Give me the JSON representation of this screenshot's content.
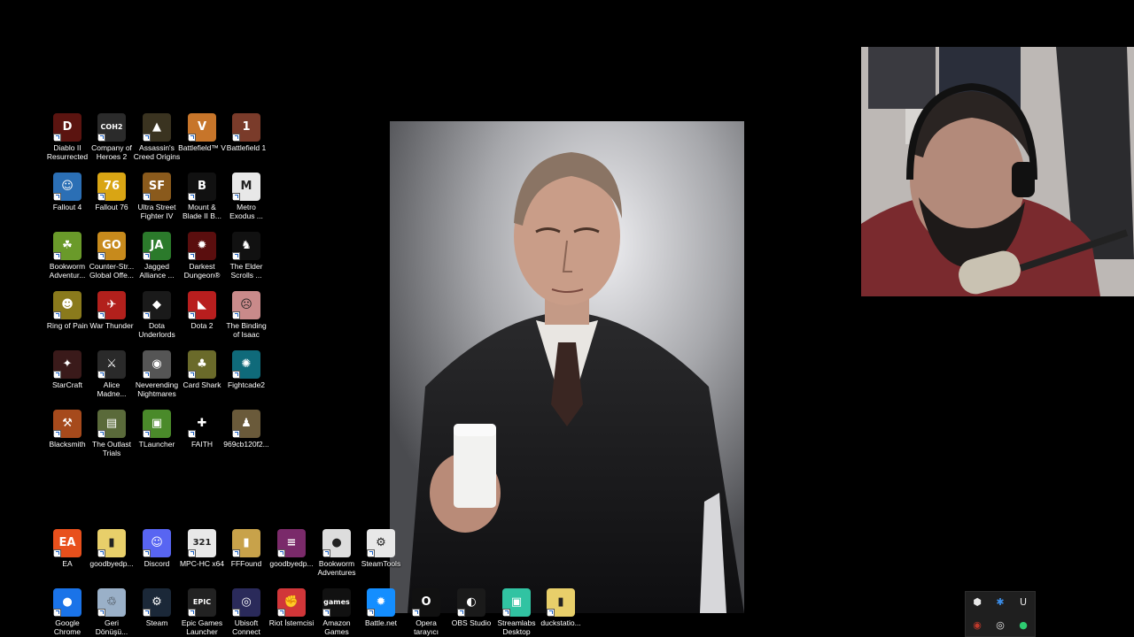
{
  "desktop": {
    "icons": [
      {
        "label": "Diablo II\nResurrected",
        "icon": "diablo-icon",
        "glyph": "D",
        "bg": "#5b1410"
      },
      {
        "label": "Company of\nHeroes 2",
        "icon": "coh2-icon",
        "glyph": "COH2",
        "bg": "#2b2b2b"
      },
      {
        "label": "Assassin's\nCreed Origins",
        "icon": "assassins-creed-icon",
        "glyph": "▲",
        "bg": "#3a3320"
      },
      {
        "label": "Battlefield™ V",
        "icon": "battlefield-v-icon",
        "glyph": "V",
        "bg": "#c7752a"
      },
      {
        "label": "Battlefield 1",
        "icon": "battlefield-1-icon",
        "glyph": "1",
        "bg": "#7a3b2a"
      },
      {
        "label": "Fallout 4",
        "icon": "fallout-4-icon",
        "glyph": "☺",
        "bg": "#2b6fb5"
      },
      {
        "label": "Fallout 76",
        "icon": "fallout-76-icon",
        "glyph": "76",
        "bg": "#d9a514"
      },
      {
        "label": "Ultra Street\nFighter IV",
        "icon": "street-fighter-icon",
        "glyph": "SF",
        "bg": "#8a5a1c"
      },
      {
        "label": "Mount &\nBlade II B...",
        "icon": "mount-blade-icon",
        "glyph": "B",
        "bg": "#111111"
      },
      {
        "label": "Metro\nExodus ...",
        "icon": "metro-exodus-icon",
        "glyph": "M",
        "bg": "#e8e8e8"
      },
      {
        "label": "Bookworm\nAdventur...",
        "icon": "bookworm-icon",
        "glyph": "☘",
        "bg": "#6a9a2a"
      },
      {
        "label": "Counter-Str...\nGlobal Offe...",
        "icon": "csgo-icon",
        "glyph": "GO",
        "bg": "#c78a1c"
      },
      {
        "label": "Jagged\nAlliance ...",
        "icon": "jagged-alliance-icon",
        "glyph": "JA",
        "bg": "#2b7a2b"
      },
      {
        "label": "Darkest\nDungeon®",
        "icon": "darkest-dungeon-icon",
        "glyph": "✹",
        "bg": "#5a0e0e"
      },
      {
        "label": "The Elder\nScrolls ...",
        "icon": "elder-scrolls-icon",
        "glyph": "♞",
        "bg": "#111111"
      },
      {
        "label": "Ring of Pain",
        "icon": "ring-of-pain-icon",
        "glyph": "☻",
        "bg": "#8a7a1c"
      },
      {
        "label": "War Thunder",
        "icon": "war-thunder-icon",
        "glyph": "✈",
        "bg": "#b2201c"
      },
      {
        "label": "Dota\nUnderlords",
        "icon": "dota-underlords-icon",
        "glyph": "◆",
        "bg": "#1a1a1a"
      },
      {
        "label": "Dota 2",
        "icon": "dota-2-icon",
        "glyph": "◣",
        "bg": "#b81e1e"
      },
      {
        "label": "The Binding\nof Isaac",
        "icon": "binding-of-isaac-icon",
        "glyph": "☹",
        "bg": "#c98a8a"
      },
      {
        "label": "StarCraft",
        "icon": "starcraft-icon",
        "glyph": "✦",
        "bg": "#3a1a1a"
      },
      {
        "label": "Alice\nMadne...",
        "icon": "alice-madness-icon",
        "glyph": "⚔",
        "bg": "#2a2a2a"
      },
      {
        "label": "Neverending\nNightmares",
        "icon": "neverending-nightmares-icon",
        "glyph": "◉",
        "bg": "#555555"
      },
      {
        "label": "Card Shark",
        "icon": "card-shark-icon",
        "glyph": "♣",
        "bg": "#6a6a2a"
      },
      {
        "label": "Fightcade2",
        "icon": "fightcade-icon",
        "glyph": "✺",
        "bg": "#0f6a7a"
      },
      {
        "label": "Blacksmith",
        "icon": "blacksmith-icon",
        "glyph": "⚒",
        "bg": "#a64a1c"
      },
      {
        "label": "The Outlast\nTrials",
        "icon": "outlast-trials-icon",
        "glyph": "▤",
        "bg": "#5a6a3a"
      },
      {
        "label": "TLauncher",
        "icon": "tlauncher-icon",
        "glyph": "▣",
        "bg": "#4a8a2a"
      },
      {
        "label": "FAITH",
        "icon": "faith-icon",
        "glyph": "✚",
        "bg": "#000000"
      },
      {
        "label": "969cb120f2...",
        "icon": "image-file-icon",
        "glyph": "♟",
        "bg": "#6a5a3a"
      },
      {
        "label": "EA",
        "icon": "ea-icon",
        "glyph": "EA",
        "bg": "#e8501c"
      },
      {
        "label": "goodbyedp...",
        "icon": "folder-icon",
        "glyph": "▮",
        "bg": "#e8cf6a"
      },
      {
        "label": "Discord",
        "icon": "discord-icon",
        "glyph": "☺",
        "bg": "#5865f2"
      },
      {
        "label": "MPC-HC x64",
        "icon": "mpc-hc-icon",
        "glyph": "321",
        "bg": "#e8e8e8"
      },
      {
        "label": "FFFound",
        "icon": "fffound-icon",
        "glyph": "▮",
        "bg": "#c8a24a"
      },
      {
        "label": "goodbyedp...",
        "icon": "archive-icon",
        "glyph": "≡",
        "bg": "#7a2a6a"
      },
      {
        "label": "Bookworm\nAdventures",
        "icon": "bookworm-file-icon",
        "glyph": "●",
        "bg": "#dddddd"
      },
      {
        "label": "SteamTools",
        "icon": "steamtools-icon",
        "glyph": "⚙",
        "bg": "#e8e8e8"
      },
      {
        "label": "Google\nChrome",
        "icon": "chrome-icon",
        "glyph": "●",
        "bg": "#1a73e8"
      },
      {
        "label": "Geri\nDönüşü...",
        "icon": "recycle-bin-icon",
        "glyph": "♲",
        "bg": "#9ab0c8"
      },
      {
        "label": "Steam",
        "icon": "steam-icon",
        "glyph": "⚙",
        "bg": "#1b2838"
      },
      {
        "label": "Epic Games\nLauncher",
        "icon": "epic-games-icon",
        "glyph": "EPIC",
        "bg": "#222222"
      },
      {
        "label": "Ubisoft\nConnect",
        "icon": "ubisoft-icon",
        "glyph": "◎",
        "bg": "#2a2a5a"
      },
      {
        "label": "Riot İstemcisi",
        "icon": "riot-icon",
        "glyph": "✊",
        "bg": "#d13639"
      },
      {
        "label": "Amazon\nGames",
        "icon": "amazon-games-icon",
        "glyph": "games",
        "bg": "#111111"
      },
      {
        "label": "Battle.net",
        "icon": "battlenet-icon",
        "glyph": "✹",
        "bg": "#148eff"
      },
      {
        "label": "Opera\ntarayıcı",
        "icon": "opera-icon",
        "glyph": "O",
        "bg": "#111111"
      },
      {
        "label": "OBS Studio",
        "icon": "obs-icon",
        "glyph": "◐",
        "bg": "#1a1a1a"
      },
      {
        "label": "Streamlabs\nDesktop",
        "icon": "streamlabs-icon",
        "glyph": "▣",
        "bg": "#31c3a2"
      },
      {
        "label": "duckstatio...",
        "icon": "duckstation-folder-icon",
        "glyph": "▮",
        "bg": "#e8cf6a"
      }
    ]
  },
  "tray": {
    "icons": [
      {
        "name": "tray-app-icon",
        "glyph": "⬢",
        "color": "#e8e8e8"
      },
      {
        "name": "bluetooth-icon",
        "glyph": "✱",
        "color": "#3b8eea"
      },
      {
        "name": "tray-u-icon",
        "glyph": "U",
        "color": "#e8e8e8"
      },
      {
        "name": "tray-red-icon",
        "glyph": "◉",
        "color": "#c0392b"
      },
      {
        "name": "obs-tray-icon",
        "glyph": "◎",
        "color": "#e8e8e8"
      },
      {
        "name": "tray-green-icon",
        "glyph": "●",
        "color": "#2ecc71"
      }
    ]
  }
}
